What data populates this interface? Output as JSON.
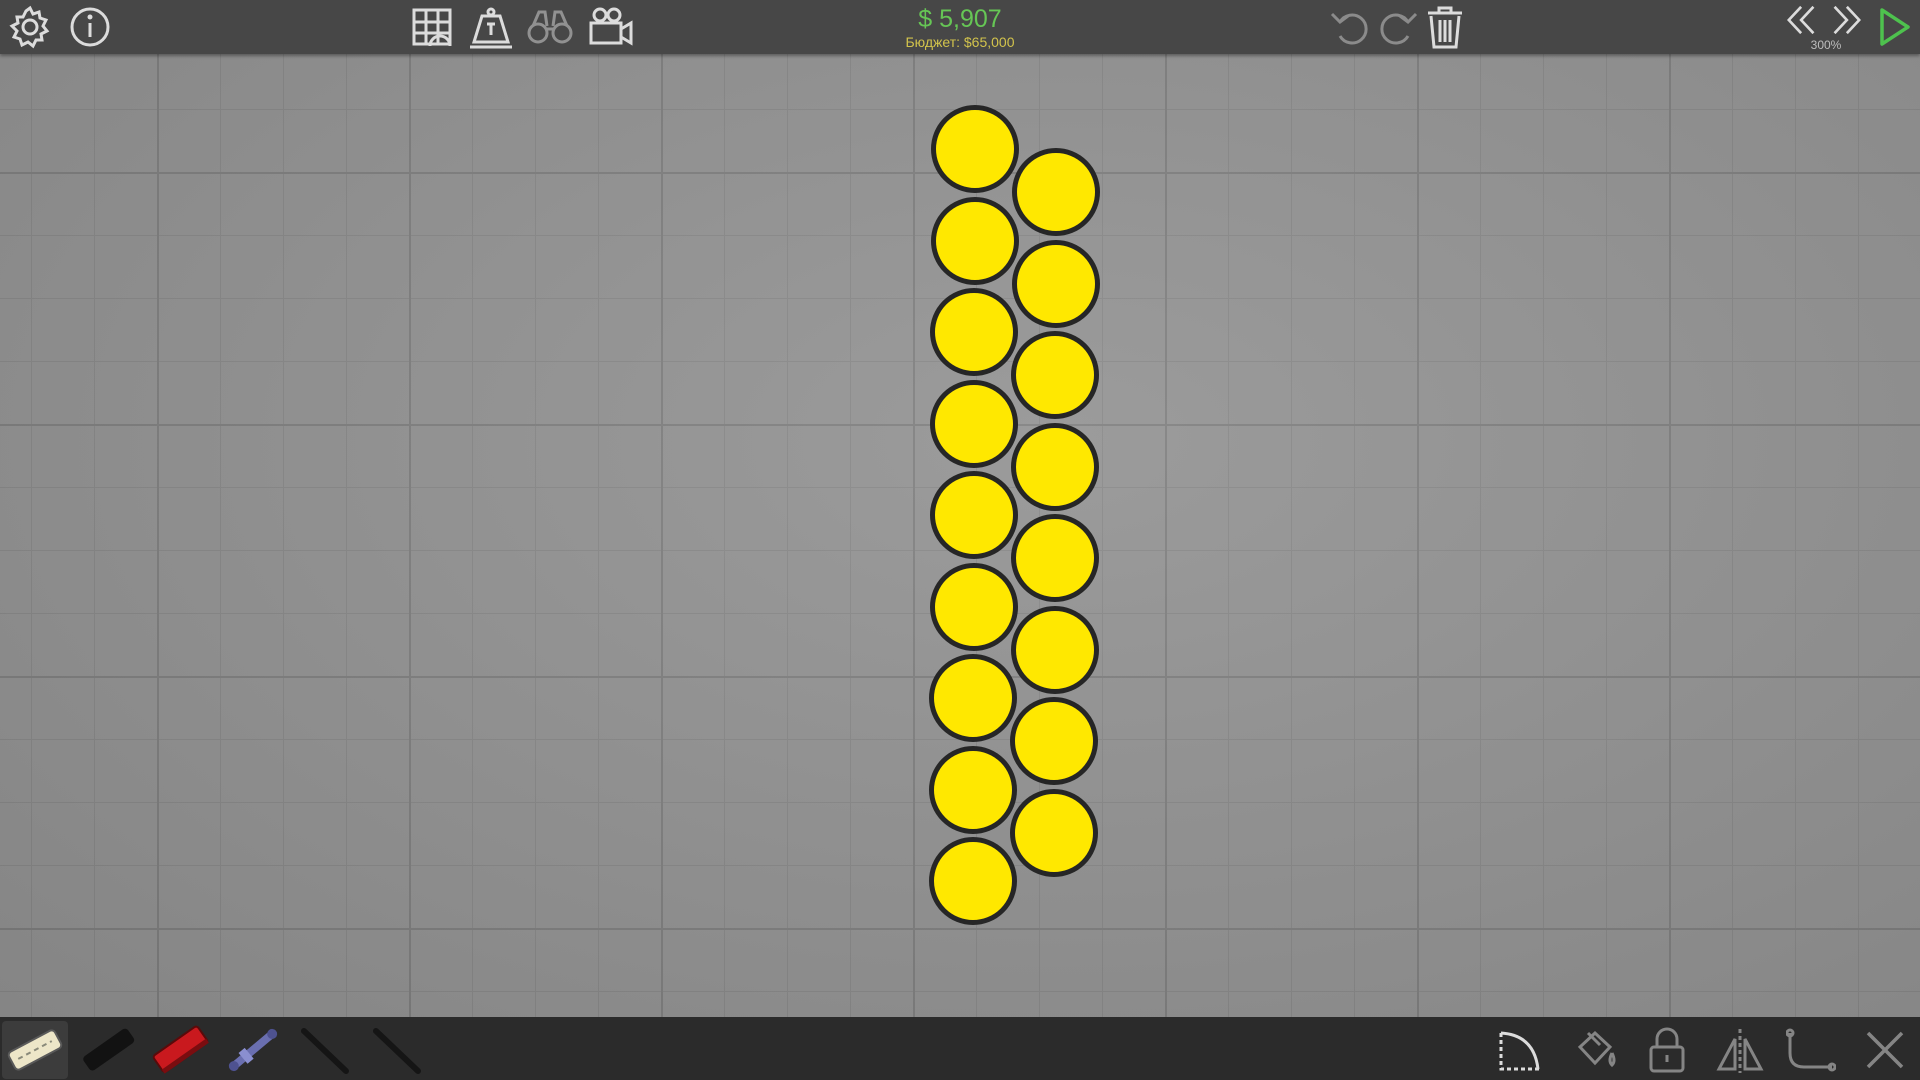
{
  "budget": {
    "money": "$ 5,907",
    "budget_line": "Бюджет: $65,000"
  },
  "zoom": {
    "label": "300%"
  },
  "colors": {
    "toolbar_bg": "#474747",
    "bottombar_bg": "#2b2b2b",
    "canvas_bg": "#909090",
    "money_green": "#66c655",
    "budget_yellow": "#d2c34c",
    "ball_fill": "#ffe800",
    "ball_outline": "#262626",
    "play_green": "#4ec24e"
  },
  "toolbar": {
    "left_icons": [
      "settings-gear-icon",
      "info-icon"
    ],
    "center_icons": [
      "grid-building-icon",
      "weight-icon",
      "binoculars-icon",
      "camera-icon"
    ],
    "edit_icons": [
      "undo-icon",
      "redo-icon",
      "trash-icon"
    ],
    "right_icons": [
      "rewind-icon",
      "fast-forward-icon",
      "play-icon"
    ]
  },
  "materials": [
    "road-material",
    "reinforced-road-material",
    "wood-material",
    "hydraulic-material",
    "rope-material",
    "steel-cable-material"
  ],
  "tools": [
    "arc-tool-icon",
    "paint-bucket-icon",
    "lock-icon",
    "mirror-icon",
    "split-joint-icon",
    "close-icon"
  ],
  "structure": {
    "left_column_count": 9,
    "right_column_count": 8
  }
}
